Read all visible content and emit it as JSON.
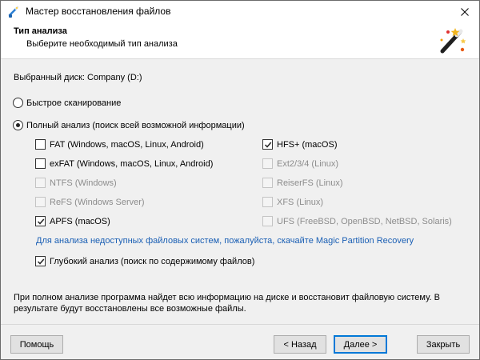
{
  "window": {
    "title": "Мастер восстановления файлов"
  },
  "header": {
    "title": "Тип анализа",
    "subtitle": "Выберите необходимый тип анализа"
  },
  "selected_disk": "Выбранный диск: Company (D:)",
  "scan_modes": {
    "quick": {
      "label": "Быстрое сканирование",
      "selected": false
    },
    "full": {
      "label": "Полный анализ (поиск всей возможной информации)",
      "selected": true
    }
  },
  "filesystems": {
    "left": [
      {
        "label": "FAT (Windows, macOS, Linux, Android)",
        "checked": false,
        "enabled": true
      },
      {
        "label": "exFAT (Windows, macOS, Linux, Android)",
        "checked": false,
        "enabled": true
      },
      {
        "label": "NTFS (Windows)",
        "checked": false,
        "enabled": false
      },
      {
        "label": "ReFS (Windows Server)",
        "checked": false,
        "enabled": false
      },
      {
        "label": "APFS (macOS)",
        "checked": true,
        "enabled": true
      }
    ],
    "right": [
      {
        "label": "HFS+ (macOS)",
        "checked": true,
        "enabled": true
      },
      {
        "label": "Ext2/3/4 (Linux)",
        "checked": false,
        "enabled": false
      },
      {
        "label": "ReiserFS (Linux)",
        "checked": false,
        "enabled": false
      },
      {
        "label": "XFS (Linux)",
        "checked": false,
        "enabled": false
      },
      {
        "label": "UFS (FreeBSD, OpenBSD, NetBSD, Solaris)",
        "checked": false,
        "enabled": false
      }
    ]
  },
  "partition_link": "Для анализа недоступных файловых систем, пожалуйста, скачайте Magic Partition Recovery",
  "deep_analysis": {
    "label": "Глубокий анализ (поиск по содержимому файлов)",
    "checked": true
  },
  "info": "При полном анализе программа найдет всю информацию на диске и восстановит файловую систему. В результате будут восстановлены все возможные файлы.",
  "buttons": {
    "help": "Помощь",
    "back": "< Назад",
    "next": "Далее >",
    "close": "Закрыть"
  },
  "icons": {
    "app": "recovery-wizard-icon",
    "close": "close-icon",
    "wand": "magic-wand-icon"
  }
}
